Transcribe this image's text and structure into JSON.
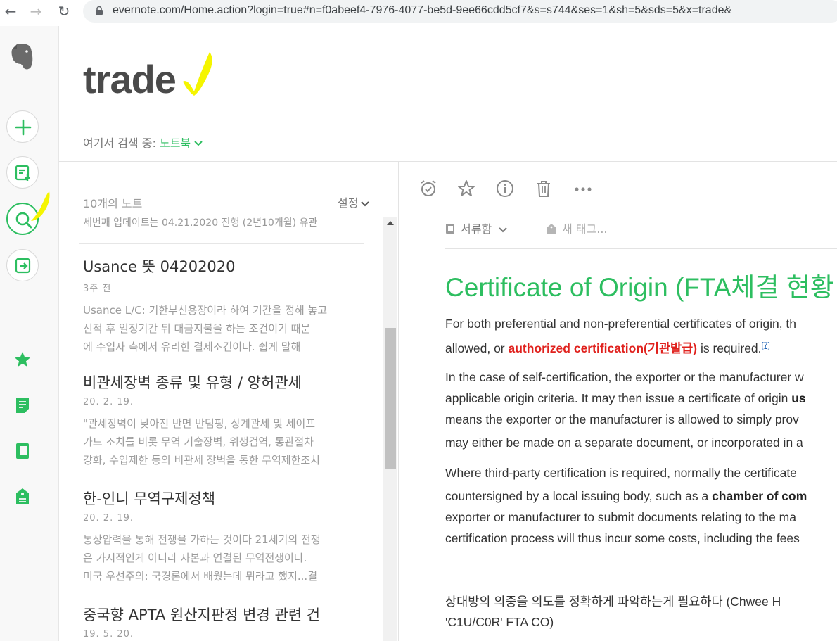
{
  "browser": {
    "url": "evernote.com/Home.action?login=true#n=f0abeef4-7976-4077-be5d-9ee66cdd5cf7&s=s744&ses=1&sh=5&sds=5&x=trade&"
  },
  "sidebar": {
    "icons": [
      "evernote-logo-icon",
      "new-note-icon",
      "new-item-icon",
      "search-icon",
      "work-chat-icon",
      "shortcuts-icon",
      "notes-icon",
      "notebooks-icon",
      "tags-icon"
    ]
  },
  "header": {
    "title": "trade",
    "search_prefix": "여기서 검색 중:",
    "search_scope": "노트북"
  },
  "notelist": {
    "count_label": "10개의 노트",
    "settings_label": "설정",
    "cut_snippet": "세번째 업데이트는 04.21.2020 진행 (2년10개월)  유관",
    "notes": [
      {
        "title": "Usance 뜻 04202020",
        "date": "3주 전",
        "snippet": [
          "Usance L/C: 기한부신용장이라 하여 기간을 정해 놓고",
          "선적 후 일정기간 뒤 대금지불을 하는 조건이기 때문",
          "에 수입자 측에서 유리한 결제조건이다. 쉽게 말해"
        ]
      },
      {
        "title": "비관세장벽 종류 및 유형 / 양허관세",
        "date": "20. 2. 19.",
        "snippet": [
          "\"관세장벽이 낮아진 반면 반덤핑, 상계관세 및 세이프",
          "가드 조치를 비롯 무역 기술장벽, 위생검역, 통관절차",
          "강화, 수입제한 등의 비관세 장벽을 통한 무역제한조치"
        ]
      },
      {
        "title": "한-인니 무역구제정책",
        "date": "20. 2. 19.",
        "snippet": [
          "통상압력을 통해 전쟁을 가하는 것이다 21세기의 전쟁",
          "은 가시적인게 아니라 자본과 연결된 무역전쟁이다.",
          "미국 우선주의: 국경론에서 배웠는데 뭐라고 했지...결"
        ]
      },
      {
        "title": "중국향 APTA 원산지판정 변경 관련 건",
        "date": "19. 5. 20.",
        "snippet": []
      }
    ]
  },
  "editor": {
    "notebook": "서류함",
    "tag_placeholder": "새 태그...",
    "doc_title": "Certificate of Origin (FTA체결 현황",
    "p1a": "For both preferential and non-preferential certificates of origin, th",
    "p1b_pre": "allowed, or ",
    "p1b_red": "authorized certification(기관발급)",
    "p1b_post": " is required.",
    "p1b_ref": "[7]",
    "p2a": "In the case of self-certification, the exporter or the manufacturer w",
    "p2b_pre": "applicable origin criteria. It may then issue a certificate of origin ",
    "p2b_bold": "us",
    "p2c": "means the exporter or the manufacturer is allowed to simply prov",
    "p2d": "may either be made on a separate document, or incorporated in a",
    "p3a": "Where third-party certification is required, normally the certificate",
    "p3b_pre": "countersigned by a local issuing body, such as a ",
    "p3b_bold": "chamber of com",
    "p3c": "exporter or manufacturer to submit documents relating to the ma",
    "p3d": "certification process will thus incur some costs, including the fees",
    "p4a": "상대방의 의중을 의도를 정확하게 파악하는게 필요하다 (Chwee H",
    "p4b": "'C1U/C0R' FTA CO)"
  },
  "colors": {
    "accent": "#2dbe60",
    "highlight": "#f5f500",
    "red": "#e0211d"
  }
}
